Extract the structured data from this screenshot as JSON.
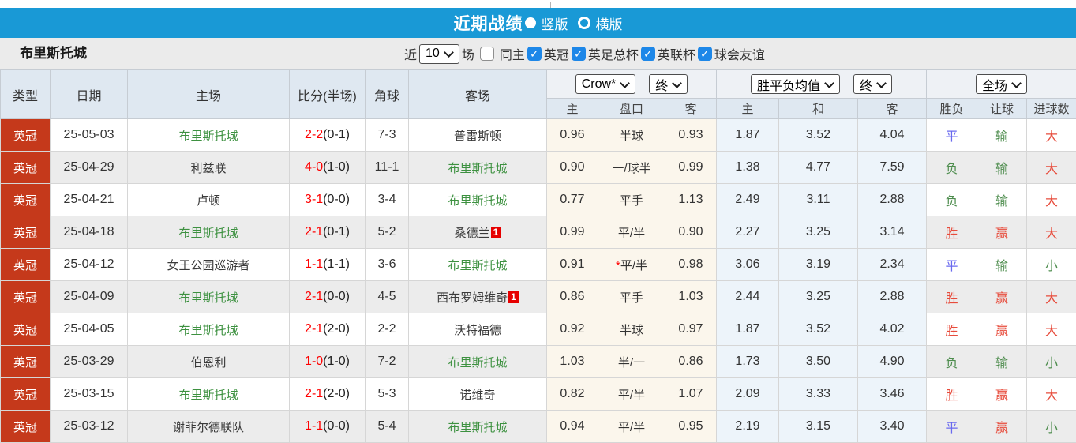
{
  "colors": {
    "header_blue": "#1999d6",
    "league_badge_red": "#c5391b",
    "self_team_green": "#3d9140",
    "score_red": "#ff0000",
    "result_win_red": "#e74c3c",
    "result_lose_green": "#4e8d4e",
    "result_draw_blue": "#6a6aef",
    "checkbox_blue": "#1d87e8",
    "red_card_badge": "#e60000"
  },
  "title_bar": {
    "title": "近期战绩",
    "vertical_label": "竖版",
    "horizontal_label": "横版",
    "selected_layout": "竖版"
  },
  "filter_bar": {
    "team": "布里斯托城",
    "recent_label": "近",
    "recent_count": "10",
    "matches_label": "场",
    "same_home_label": "同主",
    "same_home_checked": false,
    "competitions": [
      {
        "label": "英冠",
        "checked": true
      },
      {
        "label": "英足总杯",
        "checked": true
      },
      {
        "label": "英联杯",
        "checked": true
      },
      {
        "label": "球会友谊",
        "checked": true
      }
    ]
  },
  "table": {
    "left_columns": [
      "类型",
      "日期",
      "主场",
      "比分(半场)",
      "角球",
      "客场"
    ],
    "odds_group": {
      "bookmaker": "Crow*",
      "status": "终",
      "cols": [
        "主",
        "盘口",
        "客"
      ]
    },
    "avg_group": {
      "label": "胜平负均值",
      "status": "终",
      "cols": [
        "主",
        "和",
        "客"
      ]
    },
    "fulltime_group": {
      "label": "全场",
      "cols": [
        "胜负",
        "让球",
        "进球数"
      ]
    },
    "rows": [
      {
        "type": "英冠",
        "date": "25-05-03",
        "home": {
          "name": "布里斯托城",
          "self": true
        },
        "score": {
          "full": "2-2",
          "half": "(0-1)"
        },
        "corner": "7-3",
        "away": {
          "name": "普雷斯顿",
          "self": false
        },
        "odds": {
          "home": "0.96",
          "handicap": "半球",
          "star": false,
          "away": "0.93"
        },
        "avg": {
          "home": "1.87",
          "draw": "3.52",
          "away": "4.04"
        },
        "result": {
          "outcome": {
            "text": "平",
            "color": "blue"
          },
          "handicap": {
            "text": "输",
            "color": "green"
          },
          "goals": {
            "text": "大",
            "color": "red"
          }
        }
      },
      {
        "type": "英冠",
        "date": "25-04-29",
        "home": {
          "name": "利兹联",
          "self": false
        },
        "score": {
          "full": "4-0",
          "half": "(1-0)"
        },
        "corner": "11-1",
        "away": {
          "name": "布里斯托城",
          "self": true
        },
        "odds": {
          "home": "0.90",
          "handicap": "一/球半",
          "star": false,
          "away": "0.99"
        },
        "avg": {
          "home": "1.38",
          "draw": "4.77",
          "away": "7.59"
        },
        "result": {
          "outcome": {
            "text": "负",
            "color": "green"
          },
          "handicap": {
            "text": "输",
            "color": "green"
          },
          "goals": {
            "text": "大",
            "color": "red"
          }
        }
      },
      {
        "type": "英冠",
        "date": "25-04-21",
        "home": {
          "name": "卢顿",
          "self": false
        },
        "score": {
          "full": "3-1",
          "half": "(0-0)"
        },
        "corner": "3-4",
        "away": {
          "name": "布里斯托城",
          "self": true
        },
        "odds": {
          "home": "0.77",
          "handicap": "平手",
          "star": false,
          "away": "1.13"
        },
        "avg": {
          "home": "2.49",
          "draw": "3.11",
          "away": "2.88"
        },
        "result": {
          "outcome": {
            "text": "负",
            "color": "green"
          },
          "handicap": {
            "text": "输",
            "color": "green"
          },
          "goals": {
            "text": "大",
            "color": "red"
          }
        }
      },
      {
        "type": "英冠",
        "date": "25-04-18",
        "home": {
          "name": "布里斯托城",
          "self": true
        },
        "score": {
          "full": "2-1",
          "half": "(0-1)"
        },
        "corner": "5-2",
        "away": {
          "name": "桑德兰",
          "self": false,
          "card": "1"
        },
        "odds": {
          "home": "0.99",
          "handicap": "平/半",
          "star": false,
          "away": "0.90"
        },
        "avg": {
          "home": "2.27",
          "draw": "3.25",
          "away": "3.14"
        },
        "result": {
          "outcome": {
            "text": "胜",
            "color": "red"
          },
          "handicap": {
            "text": "赢",
            "color": "red"
          },
          "goals": {
            "text": "大",
            "color": "red"
          }
        }
      },
      {
        "type": "英冠",
        "date": "25-04-12",
        "home": {
          "name": "女王公园巡游者",
          "self": false
        },
        "score": {
          "full": "1-1",
          "half": "(1-1)"
        },
        "corner": "3-6",
        "away": {
          "name": "布里斯托城",
          "self": true
        },
        "odds": {
          "home": "0.91",
          "handicap": "平/半",
          "star": true,
          "away": "0.98"
        },
        "avg": {
          "home": "3.06",
          "draw": "3.19",
          "away": "2.34"
        },
        "result": {
          "outcome": {
            "text": "平",
            "color": "blue"
          },
          "handicap": {
            "text": "输",
            "color": "green"
          },
          "goals": {
            "text": "小",
            "color": "green"
          }
        }
      },
      {
        "type": "英冠",
        "date": "25-04-09",
        "home": {
          "name": "布里斯托城",
          "self": true
        },
        "score": {
          "full": "2-1",
          "half": "(0-0)"
        },
        "corner": "4-5",
        "away": {
          "name": "西布罗姆维奇",
          "self": false,
          "card": "1"
        },
        "odds": {
          "home": "0.86",
          "handicap": "平手",
          "star": false,
          "away": "1.03"
        },
        "avg": {
          "home": "2.44",
          "draw": "3.25",
          "away": "2.88"
        },
        "result": {
          "outcome": {
            "text": "胜",
            "color": "red"
          },
          "handicap": {
            "text": "赢",
            "color": "red"
          },
          "goals": {
            "text": "大",
            "color": "red"
          }
        }
      },
      {
        "type": "英冠",
        "date": "25-04-05",
        "home": {
          "name": "布里斯托城",
          "self": true
        },
        "score": {
          "full": "2-1",
          "half": "(2-0)"
        },
        "corner": "2-2",
        "away": {
          "name": "沃特福德",
          "self": false
        },
        "odds": {
          "home": "0.92",
          "handicap": "半球",
          "star": false,
          "away": "0.97"
        },
        "avg": {
          "home": "1.87",
          "draw": "3.52",
          "away": "4.02"
        },
        "result": {
          "outcome": {
            "text": "胜",
            "color": "red"
          },
          "handicap": {
            "text": "赢",
            "color": "red"
          },
          "goals": {
            "text": "大",
            "color": "red"
          }
        }
      },
      {
        "type": "英冠",
        "date": "25-03-29",
        "home": {
          "name": "伯恩利",
          "self": false
        },
        "score": {
          "full": "1-0",
          "half": "(1-0)"
        },
        "corner": "7-2",
        "away": {
          "name": "布里斯托城",
          "self": true
        },
        "odds": {
          "home": "1.03",
          "handicap": "半/一",
          "star": false,
          "away": "0.86"
        },
        "avg": {
          "home": "1.73",
          "draw": "3.50",
          "away": "4.90"
        },
        "result": {
          "outcome": {
            "text": "负",
            "color": "green"
          },
          "handicap": {
            "text": "输",
            "color": "green"
          },
          "goals": {
            "text": "小",
            "color": "green"
          }
        }
      },
      {
        "type": "英冠",
        "date": "25-03-15",
        "home": {
          "name": "布里斯托城",
          "self": true
        },
        "score": {
          "full": "2-1",
          "half": "(2-0)"
        },
        "corner": "5-3",
        "away": {
          "name": "诺维奇",
          "self": false
        },
        "odds": {
          "home": "0.82",
          "handicap": "平/半",
          "star": false,
          "away": "1.07"
        },
        "avg": {
          "home": "2.09",
          "draw": "3.33",
          "away": "3.46"
        },
        "result": {
          "outcome": {
            "text": "胜",
            "color": "red"
          },
          "handicap": {
            "text": "赢",
            "color": "red"
          },
          "goals": {
            "text": "大",
            "color": "red"
          }
        }
      },
      {
        "type": "英冠",
        "date": "25-03-12",
        "home": {
          "name": "谢菲尔德联队",
          "self": false
        },
        "score": {
          "full": "1-1",
          "half": "(0-0)"
        },
        "corner": "5-4",
        "away": {
          "name": "布里斯托城",
          "self": true
        },
        "odds": {
          "home": "0.94",
          "handicap": "平/半",
          "star": false,
          "away": "0.95"
        },
        "avg": {
          "home": "2.19",
          "draw": "3.15",
          "away": "3.40"
        },
        "result": {
          "outcome": {
            "text": "平",
            "color": "blue"
          },
          "handicap": {
            "text": "赢",
            "color": "red"
          },
          "goals": {
            "text": "小",
            "color": "green"
          }
        }
      }
    ]
  }
}
